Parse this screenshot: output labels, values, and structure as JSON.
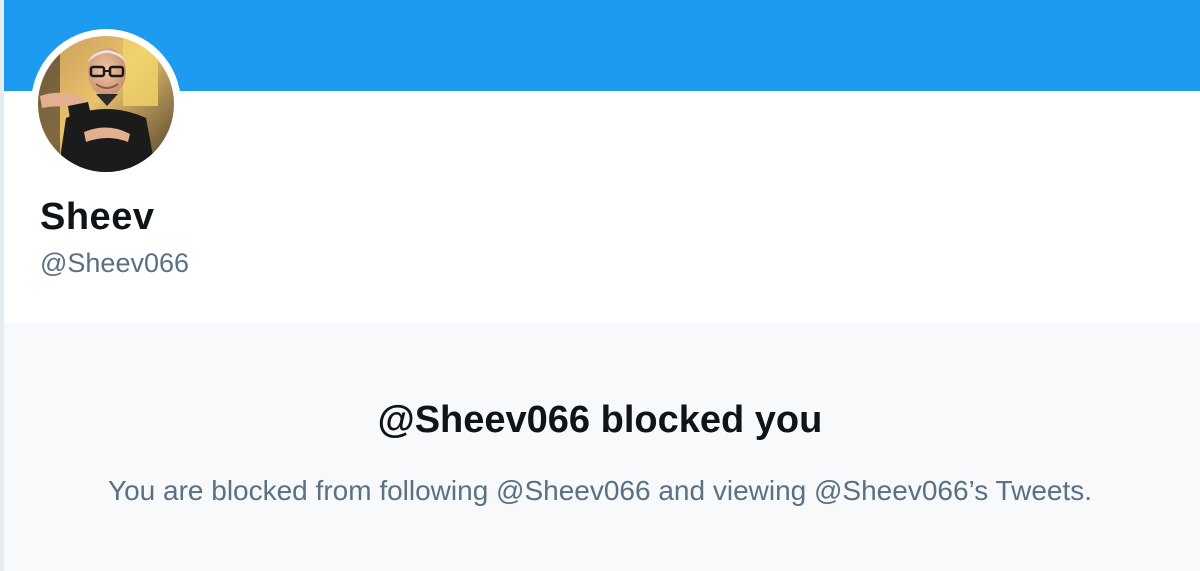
{
  "profile": {
    "display_name": "Sheev",
    "handle": "@Sheev066"
  },
  "blocked_notice": {
    "title": "@Sheev066 blocked you",
    "message": "You are blocked from following @Sheev066 and viewing @Sheev066’s Tweets."
  },
  "colors": {
    "banner": "#1d9bf0",
    "primary_text": "#0f1419",
    "secondary_text": "#5b7083",
    "panel_background": "#f7f9fa"
  }
}
